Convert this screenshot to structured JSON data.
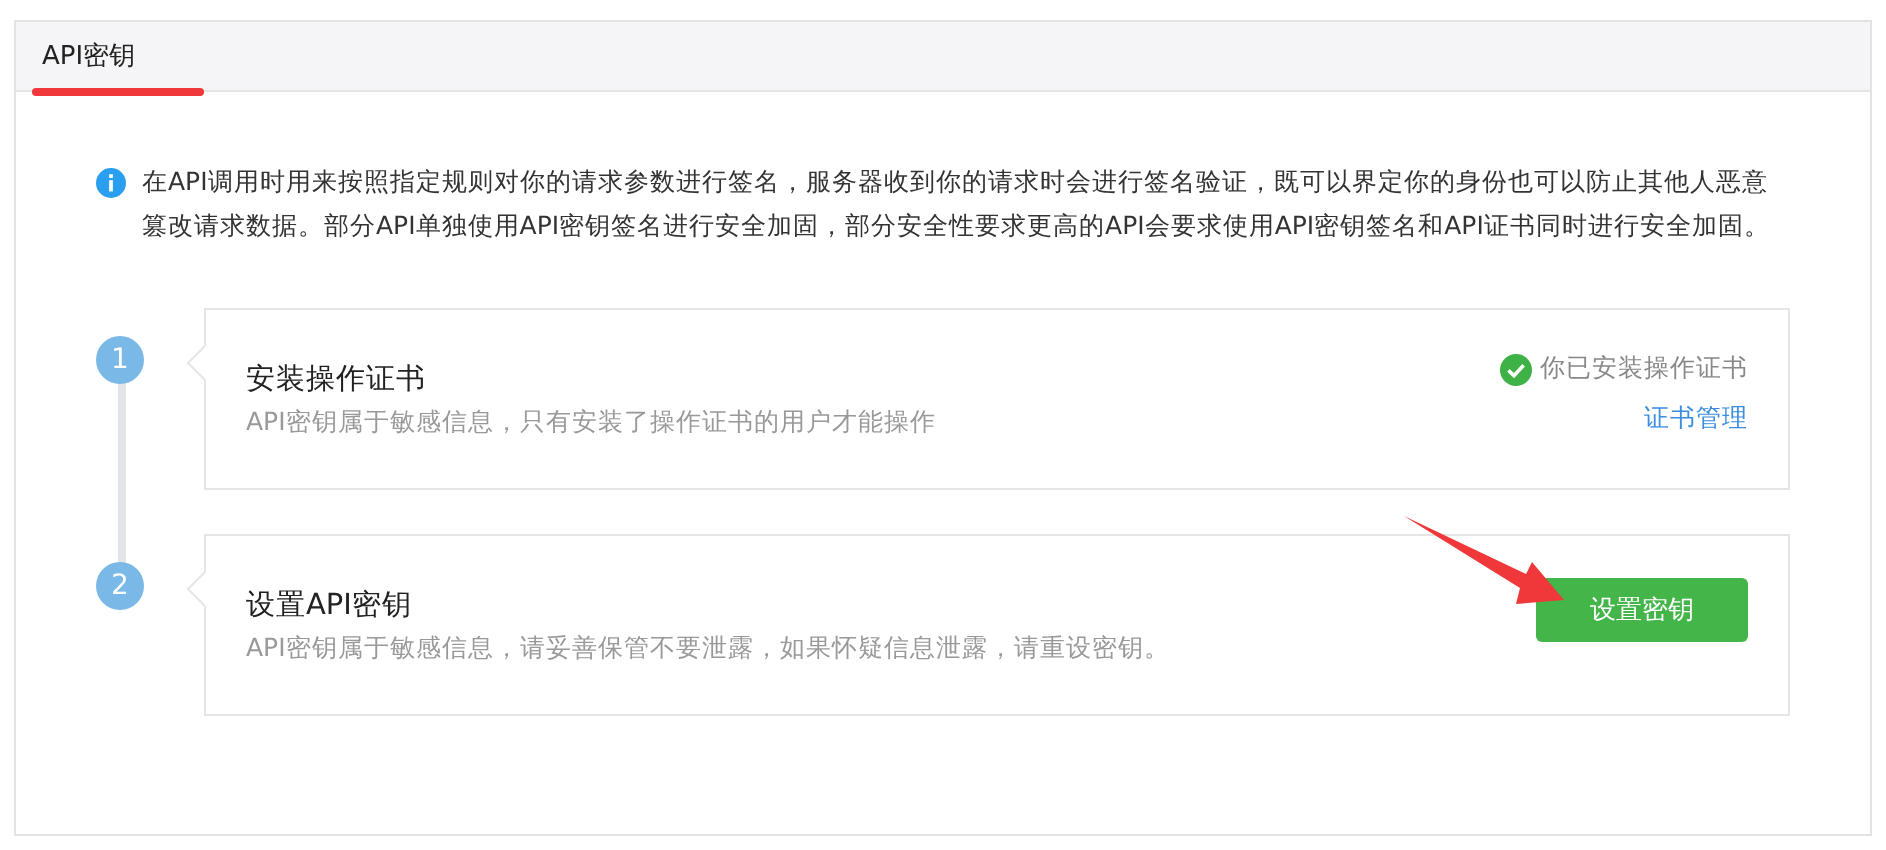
{
  "tab": {
    "label": "API密钥"
  },
  "notice": {
    "text": "在API调用时用来按照指定规则对你的请求参数进行签名，服务器收到你的请求时会进行签名验证，既可以界定你的身份也可以防止其他人恶意篡改请求数据。部分API单独使用API密钥签名进行安全加固，部分安全性要求更高的API会要求使用API密钥签名和API证书同时进行安全加固。"
  },
  "steps": [
    {
      "number": "1",
      "kind": "status",
      "title": "安装操作证书",
      "description": "API密钥属于敏感信息，只有安装了操作证书的用户才能操作",
      "status": "你已安装操作证书",
      "link": "证书管理"
    },
    {
      "number": "2",
      "kind": "action",
      "title": "设置API密钥",
      "description": "API密钥属于敏感信息，请妥善保管不要泄露，如果怀疑信息泄露，请重设密钥。",
      "button": "设置密钥"
    }
  ]
}
